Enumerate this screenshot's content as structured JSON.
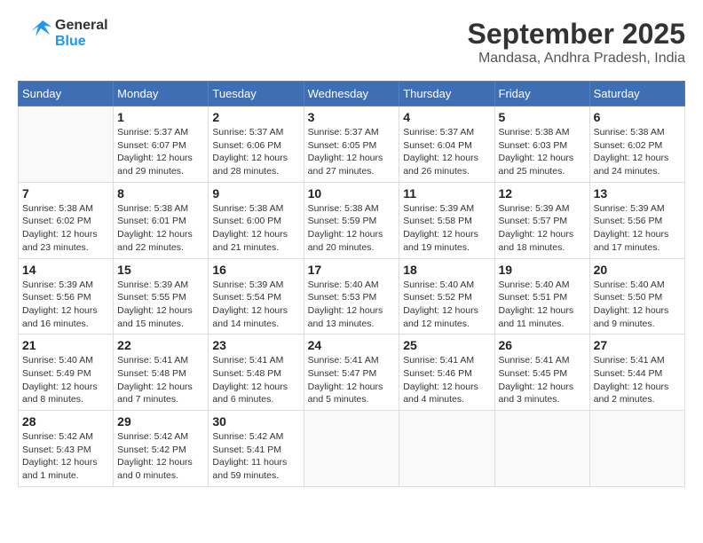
{
  "header": {
    "logo_line1": "General",
    "logo_line2": "Blue",
    "month": "September 2025",
    "location": "Mandasa, Andhra Pradesh, India"
  },
  "days_of_week": [
    "Sunday",
    "Monday",
    "Tuesday",
    "Wednesday",
    "Thursday",
    "Friday",
    "Saturday"
  ],
  "weeks": [
    [
      {
        "day": "",
        "info": ""
      },
      {
        "day": "1",
        "info": "Sunrise: 5:37 AM\nSunset: 6:07 PM\nDaylight: 12 hours\nand 29 minutes."
      },
      {
        "day": "2",
        "info": "Sunrise: 5:37 AM\nSunset: 6:06 PM\nDaylight: 12 hours\nand 28 minutes."
      },
      {
        "day": "3",
        "info": "Sunrise: 5:37 AM\nSunset: 6:05 PM\nDaylight: 12 hours\nand 27 minutes."
      },
      {
        "day": "4",
        "info": "Sunrise: 5:37 AM\nSunset: 6:04 PM\nDaylight: 12 hours\nand 26 minutes."
      },
      {
        "day": "5",
        "info": "Sunrise: 5:38 AM\nSunset: 6:03 PM\nDaylight: 12 hours\nand 25 minutes."
      },
      {
        "day": "6",
        "info": "Sunrise: 5:38 AM\nSunset: 6:02 PM\nDaylight: 12 hours\nand 24 minutes."
      }
    ],
    [
      {
        "day": "7",
        "info": "Sunrise: 5:38 AM\nSunset: 6:02 PM\nDaylight: 12 hours\nand 23 minutes."
      },
      {
        "day": "8",
        "info": "Sunrise: 5:38 AM\nSunset: 6:01 PM\nDaylight: 12 hours\nand 22 minutes."
      },
      {
        "day": "9",
        "info": "Sunrise: 5:38 AM\nSunset: 6:00 PM\nDaylight: 12 hours\nand 21 minutes."
      },
      {
        "day": "10",
        "info": "Sunrise: 5:38 AM\nSunset: 5:59 PM\nDaylight: 12 hours\nand 20 minutes."
      },
      {
        "day": "11",
        "info": "Sunrise: 5:39 AM\nSunset: 5:58 PM\nDaylight: 12 hours\nand 19 minutes."
      },
      {
        "day": "12",
        "info": "Sunrise: 5:39 AM\nSunset: 5:57 PM\nDaylight: 12 hours\nand 18 minutes."
      },
      {
        "day": "13",
        "info": "Sunrise: 5:39 AM\nSunset: 5:56 PM\nDaylight: 12 hours\nand 17 minutes."
      }
    ],
    [
      {
        "day": "14",
        "info": "Sunrise: 5:39 AM\nSunset: 5:56 PM\nDaylight: 12 hours\nand 16 minutes."
      },
      {
        "day": "15",
        "info": "Sunrise: 5:39 AM\nSunset: 5:55 PM\nDaylight: 12 hours\nand 15 minutes."
      },
      {
        "day": "16",
        "info": "Sunrise: 5:39 AM\nSunset: 5:54 PM\nDaylight: 12 hours\nand 14 minutes."
      },
      {
        "day": "17",
        "info": "Sunrise: 5:40 AM\nSunset: 5:53 PM\nDaylight: 12 hours\nand 13 minutes."
      },
      {
        "day": "18",
        "info": "Sunrise: 5:40 AM\nSunset: 5:52 PM\nDaylight: 12 hours\nand 12 minutes."
      },
      {
        "day": "19",
        "info": "Sunrise: 5:40 AM\nSunset: 5:51 PM\nDaylight: 12 hours\nand 11 minutes."
      },
      {
        "day": "20",
        "info": "Sunrise: 5:40 AM\nSunset: 5:50 PM\nDaylight: 12 hours\nand 9 minutes."
      }
    ],
    [
      {
        "day": "21",
        "info": "Sunrise: 5:40 AM\nSunset: 5:49 PM\nDaylight: 12 hours\nand 8 minutes."
      },
      {
        "day": "22",
        "info": "Sunrise: 5:41 AM\nSunset: 5:48 PM\nDaylight: 12 hours\nand 7 minutes."
      },
      {
        "day": "23",
        "info": "Sunrise: 5:41 AM\nSunset: 5:48 PM\nDaylight: 12 hours\nand 6 minutes."
      },
      {
        "day": "24",
        "info": "Sunrise: 5:41 AM\nSunset: 5:47 PM\nDaylight: 12 hours\nand 5 minutes."
      },
      {
        "day": "25",
        "info": "Sunrise: 5:41 AM\nSunset: 5:46 PM\nDaylight: 12 hours\nand 4 minutes."
      },
      {
        "day": "26",
        "info": "Sunrise: 5:41 AM\nSunset: 5:45 PM\nDaylight: 12 hours\nand 3 minutes."
      },
      {
        "day": "27",
        "info": "Sunrise: 5:41 AM\nSunset: 5:44 PM\nDaylight: 12 hours\nand 2 minutes."
      }
    ],
    [
      {
        "day": "28",
        "info": "Sunrise: 5:42 AM\nSunset: 5:43 PM\nDaylight: 12 hours\nand 1 minute."
      },
      {
        "day": "29",
        "info": "Sunrise: 5:42 AM\nSunset: 5:42 PM\nDaylight: 12 hours\nand 0 minutes."
      },
      {
        "day": "30",
        "info": "Sunrise: 5:42 AM\nSunset: 5:41 PM\nDaylight: 11 hours\nand 59 minutes."
      },
      {
        "day": "",
        "info": ""
      },
      {
        "day": "",
        "info": ""
      },
      {
        "day": "",
        "info": ""
      },
      {
        "day": "",
        "info": ""
      }
    ]
  ]
}
